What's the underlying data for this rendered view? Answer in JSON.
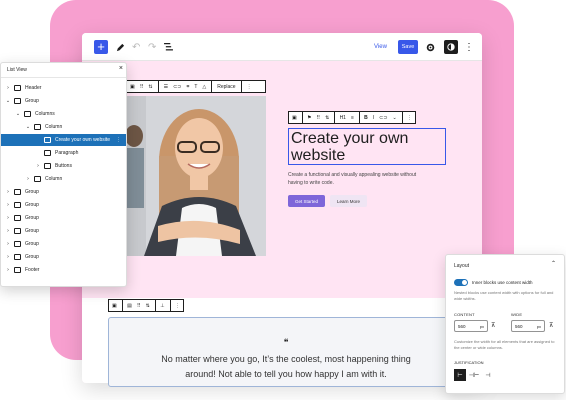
{
  "topbar": {
    "add_label": "+",
    "view_label": "View",
    "save_label": "Save"
  },
  "image_toolbar": {
    "replace_label": "Replace"
  },
  "heading_toolbar": {
    "level_label": "H1",
    "bold_label": "B",
    "italic_label": "I"
  },
  "hero": {
    "heading": "Create your own website",
    "paragraph": "Create a functional and visually appealing website without having to write code.",
    "primary_button": "Get Started",
    "secondary_button": "Learn More"
  },
  "quote": {
    "mark": "❝",
    "text": "No matter where you go, It’s the coolest, most happening thing around! Not able to tell you how happy I am with it."
  },
  "list_view": {
    "title": "List View",
    "close": "×",
    "rows": [
      {
        "label": "Header",
        "depth": 0,
        "chev": "›",
        "selected": false
      },
      {
        "label": "Group",
        "depth": 0,
        "chev": "⌄",
        "selected": false
      },
      {
        "label": "Columns",
        "depth": 1,
        "chev": "⌄",
        "selected": false
      },
      {
        "label": "Column",
        "depth": 2,
        "chev": "⌄",
        "selected": false
      },
      {
        "label": "Create your own website",
        "depth": 3,
        "chev": "",
        "selected": true
      },
      {
        "label": "Paragraph",
        "depth": 3,
        "chev": "",
        "selected": false
      },
      {
        "label": "Buttons",
        "depth": 3,
        "chev": "›",
        "selected": false
      },
      {
        "label": "Column",
        "depth": 2,
        "chev": "›",
        "selected": false
      },
      {
        "label": "Group",
        "depth": 0,
        "chev": "›",
        "selected": false
      },
      {
        "label": "Group",
        "depth": 0,
        "chev": "›",
        "selected": false
      },
      {
        "label": "Group",
        "depth": 0,
        "chev": "›",
        "selected": false
      },
      {
        "label": "Group",
        "depth": 0,
        "chev": "›",
        "selected": false
      },
      {
        "label": "Group",
        "depth": 0,
        "chev": "›",
        "selected": false
      },
      {
        "label": "Group",
        "depth": 0,
        "chev": "›",
        "selected": false
      },
      {
        "label": "Footer",
        "depth": 0,
        "chev": "›",
        "selected": false
      }
    ]
  },
  "layout_panel": {
    "title": "Layout",
    "toggle_label": "Inner blocks use content width",
    "toggle_on": true,
    "help": "Nested blocks use content width with options for full and wide widths.",
    "content_label": "CONTENT",
    "content_value": "560",
    "content_unit": "px",
    "wide_label": "WIDE",
    "wide_value": "560",
    "wide_unit": "px",
    "description": "Customize the width for all elements that are assigned to the center or wide columns.",
    "justification_label": "JUSTIFICATION"
  },
  "colors": {
    "accent": "#3858e9",
    "pink_background": "#f79fcf",
    "canvas_pink": "#ffe4f3",
    "selection_blue": "#1d71b8",
    "button_purple": "#7e66d9"
  }
}
